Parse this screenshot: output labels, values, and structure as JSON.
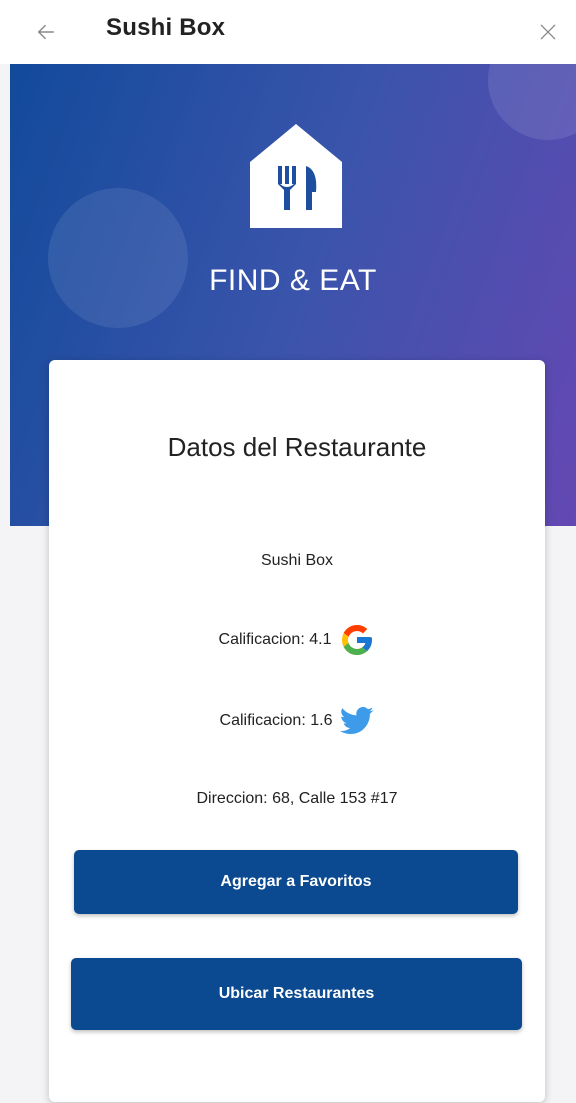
{
  "header": {
    "title": "Sushi Box",
    "back_icon": "arrow-left-icon",
    "close_icon": "close-icon"
  },
  "hero": {
    "brand": "FIND & EAT",
    "logo_icon": "restaurant-house-icon",
    "gradient_start": "#124a9b",
    "gradient_end": "#6448b3"
  },
  "card": {
    "title": "Datos del Restaurante",
    "name": "Sushi Box",
    "google_rating": "Calificacion: 4.1",
    "google_icon": "google-icon",
    "twitter_rating": "Calificacion: 1.6",
    "twitter_icon": "twitter-icon",
    "address": "Direccion: 68, Calle 153 #17"
  },
  "buttons": {
    "favorites_label": "Agregar a Favoritos",
    "locate_label": "Ubicar Restaurantes",
    "color": "#0b4a90"
  }
}
